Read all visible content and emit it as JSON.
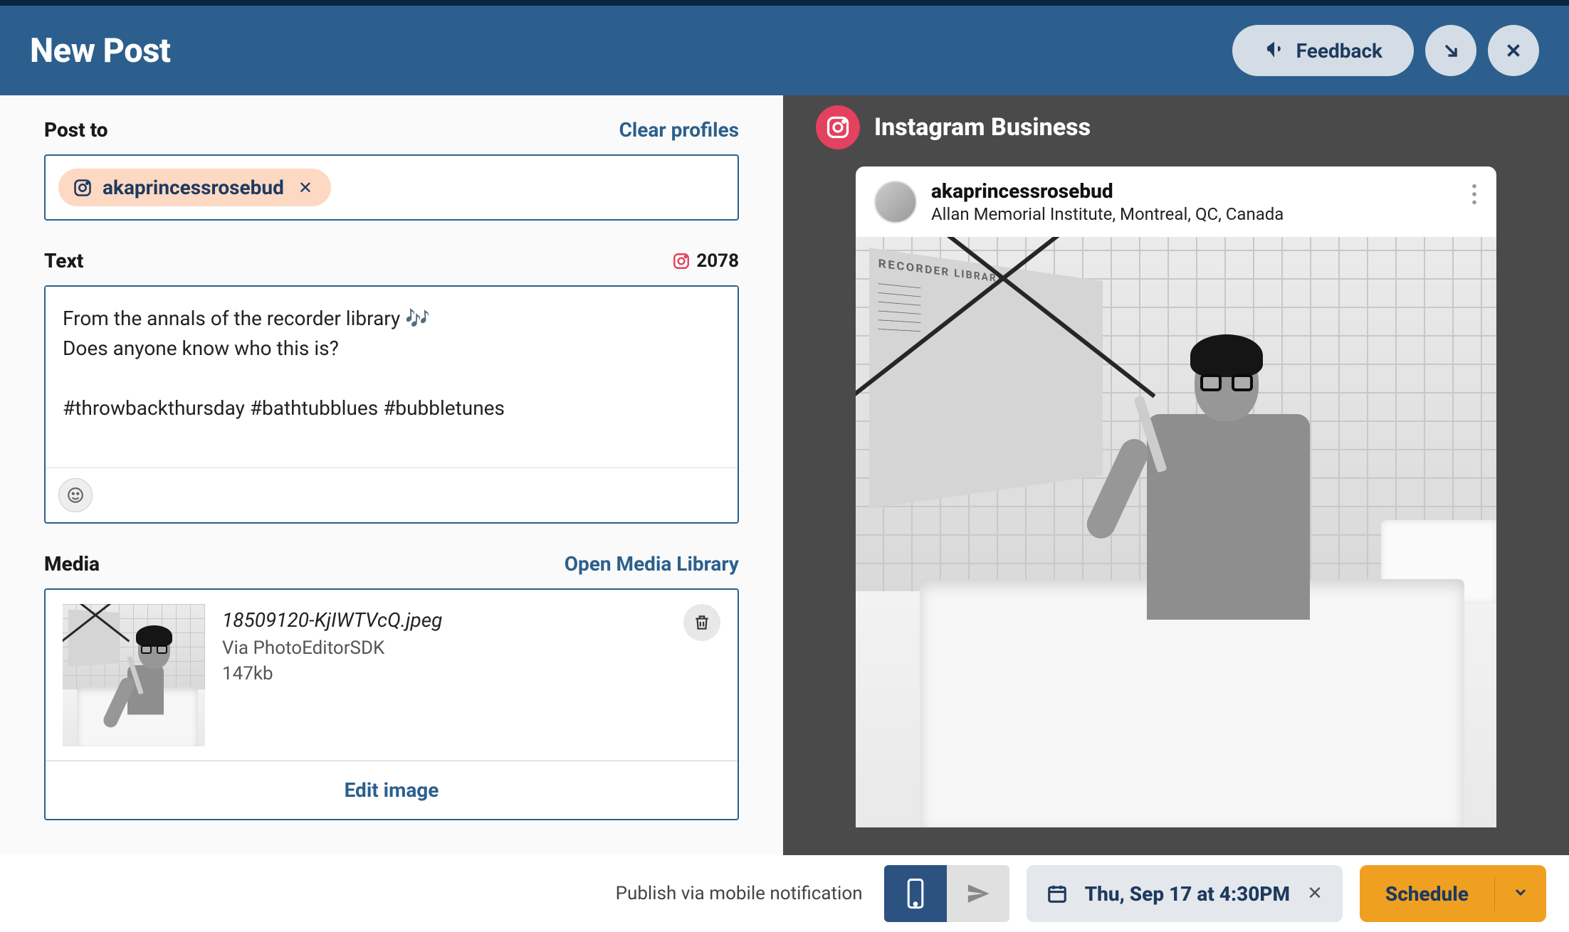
{
  "header": {
    "title": "New Post",
    "feedback": "Feedback"
  },
  "post_to": {
    "label": "Post to",
    "clear": "Clear profiles",
    "profile_name": "akaprincessrosebud"
  },
  "text_section": {
    "label": "Text",
    "counter": "2078",
    "content": "From the annals of the recorder library 🎶\nDoes anyone know who this is?\n\n#throwbackthursday #bathtubblues #bubbletunes"
  },
  "media": {
    "label": "Media",
    "open_library": "Open Media Library",
    "filename": "18509120-KjIWTVcQ.jpeg",
    "source": "Via PhotoEditorSDK",
    "size": "147kb",
    "edit_image": "Edit image"
  },
  "preview": {
    "platform": "Instagram Business",
    "username": "akaprincessrosebud",
    "location": "Allan Memorial Institute, Montreal, QC, Canada",
    "sheet_title": "RECORDER LIBRARY"
  },
  "footer": {
    "publish_label": "Publish via mobile notification",
    "date": "Thu, Sep 17 at 4:30PM",
    "schedule": "Schedule"
  }
}
